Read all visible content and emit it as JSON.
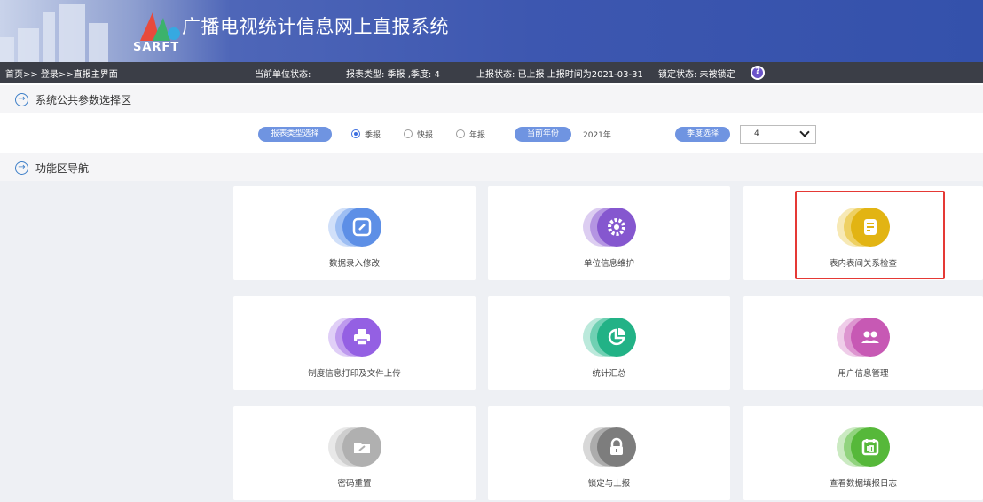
{
  "app": {
    "title": "广播电视统计信息网上直报系统",
    "logo_text": "SARFT"
  },
  "status": {
    "breadcrumb": "首页>> 登录>>直报主界面",
    "unit_status": "当前单位状态:",
    "report_type": "报表类型: 季报 ,季度: 4",
    "report_state": "上报状态: 已上报  上报时间为2021-03-31",
    "lock_state": "锁定状态: 未被锁定"
  },
  "params_section": {
    "title": "系统公共参数选择区",
    "report_type_label": "报表类型选择",
    "radios": [
      {
        "label": "季报",
        "checked": true
      },
      {
        "label": "快报",
        "checked": false
      },
      {
        "label": "年报",
        "checked": false
      }
    ],
    "year_label": "当前年份",
    "year_value": "2021年",
    "quarter_label": "季度选择",
    "quarter_value": "4"
  },
  "nav_section": {
    "title": "功能区导航",
    "tiles": [
      {
        "label": "数据录入修改",
        "icon": "edit-icon",
        "color": "#7aa6ee"
      },
      {
        "label": "单位信息维护",
        "icon": "gear-icon",
        "color": "#9a6fd8"
      },
      {
        "label": "表内表间关系检查",
        "icon": "checklist-icon",
        "color": "#e8bf2c"
      },
      {
        "label": "制度信息打印及文件上传",
        "icon": "printer-icon",
        "color": "#a676e8"
      },
      {
        "label": "统计汇总",
        "icon": "pie-chart-icon",
        "color": "#3dbf97"
      },
      {
        "label": "用户信息管理",
        "icon": "users-icon",
        "color": "#d070c0"
      },
      {
        "label": "密码重置",
        "icon": "key-folder-icon",
        "color": "#bdbdbd"
      },
      {
        "label": "锁定与上报",
        "icon": "lock-icon",
        "color": "#8f8f8f"
      },
      {
        "label": "查看数据填报日志",
        "icon": "calendar-icon",
        "color": "#6ac350"
      }
    ]
  }
}
